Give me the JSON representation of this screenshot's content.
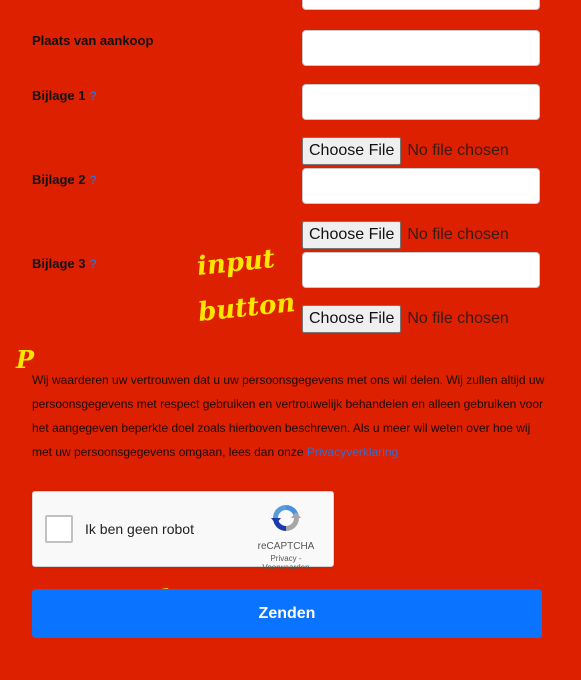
{
  "form": {
    "place_label": "Plaats van aankoop",
    "help_symbol": "?",
    "attachments": [
      {
        "label": "Bijlage 1"
      },
      {
        "label": "Bijlage 2"
      },
      {
        "label": "Bijlage 3"
      }
    ],
    "file_button": "Choose File",
    "file_status": "No file chosen"
  },
  "privacy": {
    "text": "Wij waarderen uw vertrouwen dat u uw persoonsgegevens met ons wil delen. Wij zullen altijd uw persoonsgegevens met respect gebruiken en vertrouwelijk behandelen en alleen gebruiken voor het aangegeven beperkte doel zoals hierboven beschreven. Als u meer wil weten over hoe wij met uw persoonsgegevens omgaan, lees dan onze ",
    "link": "Privacyverklaring"
  },
  "captcha": {
    "label": "Ik ben geen robot",
    "brand": "reCAPTCHA",
    "links": "Privacy - Voorwaarden"
  },
  "submit": {
    "label": "Zenden"
  },
  "annotations": {
    "input_1": "input",
    "button": "button",
    "p": "P",
    "input_2": "input"
  },
  "colors": {
    "background": "#dd2000",
    "submit": "#0a73ff",
    "link": "#3a6cc9",
    "annotation": "#ffe600"
  }
}
